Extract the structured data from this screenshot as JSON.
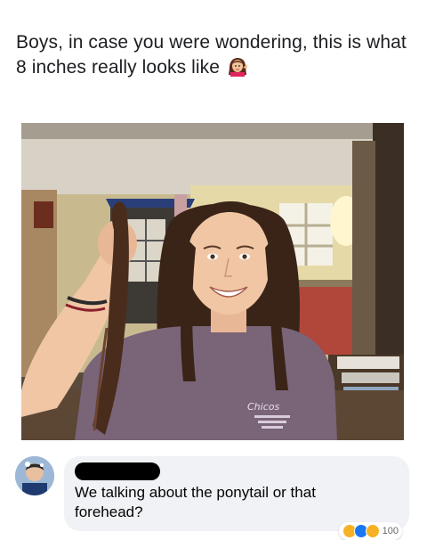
{
  "post": {
    "text": "Boys, in case you were wondering, this is what 8 inches really looks like"
  },
  "photo": {
    "shirt_text": "Chicos",
    "icon": "woman-holding-ponytail-photo"
  },
  "comment": {
    "author": "",
    "text": "We talking about the ponytail or that forehead?",
    "reaction_count": "100"
  },
  "colors": {
    "text": "#1c1e21",
    "bubble": "#f0f2f5",
    "shirt": "#7a6478"
  }
}
